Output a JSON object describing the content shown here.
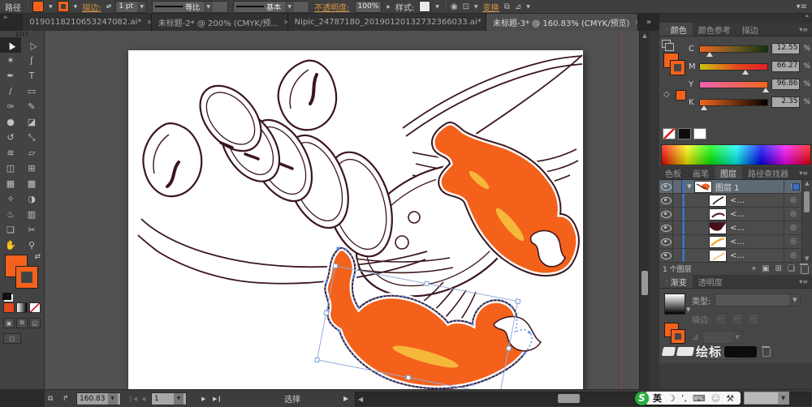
{
  "control_bar": {
    "context_label": "路径",
    "stroke_link": "描边:",
    "stroke_weight": "1 pt",
    "profile_label": "等比",
    "brush_label": "基本",
    "opacity_link": "不透明度:",
    "opacity_value": "100%",
    "style_label": "样式:",
    "transform_link": "变换"
  },
  "tab_bar": {
    "tabs": [
      {
        "label": "0190118210653247082.ai*",
        "close": "×"
      },
      {
        "label": "未标题-2* @ 200% (CMYK/预...",
        "close": "×"
      },
      {
        "label": "Nipic_24787180_20190120132732366033.ai*",
        "close": "×"
      },
      {
        "label": "未标题-3* @ 160.83% (CMYK/预览)",
        "close": "×"
      }
    ],
    "overflow": "»"
  },
  "toolbar": {
    "tools": [
      {
        "name": "selection",
        "glyph": "▲"
      },
      {
        "name": "direct-selection",
        "glyph": "△"
      },
      {
        "name": "magic-wand",
        "glyph": "✶"
      },
      {
        "name": "lasso",
        "glyph": "ʃ"
      },
      {
        "name": "pen",
        "glyph": "✒"
      },
      {
        "name": "type",
        "glyph": "T"
      },
      {
        "name": "line-segment",
        "glyph": "∕"
      },
      {
        "name": "rectangle",
        "glyph": "▭"
      },
      {
        "name": "paintbrush",
        "glyph": "✑"
      },
      {
        "name": "pencil",
        "glyph": "✎"
      },
      {
        "name": "blob-brush",
        "glyph": "●"
      },
      {
        "name": "eraser",
        "glyph": "◪"
      },
      {
        "name": "rotate",
        "glyph": "↺"
      },
      {
        "name": "scale",
        "glyph": "⤡"
      },
      {
        "name": "width",
        "glyph": "≋"
      },
      {
        "name": "free-transform",
        "glyph": "▱"
      },
      {
        "name": "shape-builder",
        "glyph": "◫"
      },
      {
        "name": "perspective-grid",
        "glyph": "⊞"
      },
      {
        "name": "mesh",
        "glyph": "▦"
      },
      {
        "name": "gradient",
        "glyph": "▩"
      },
      {
        "name": "eyedropper",
        "glyph": "✧"
      },
      {
        "name": "blend",
        "glyph": "◑"
      },
      {
        "name": "symbol-sprayer",
        "glyph": "♨"
      },
      {
        "name": "column-graph",
        "glyph": "▥"
      },
      {
        "name": "artboard",
        "glyph": "❏"
      },
      {
        "name": "slice",
        "glyph": "✂"
      },
      {
        "name": "hand",
        "glyph": "✋"
      },
      {
        "name": "zoom",
        "glyph": "⚲"
      }
    ]
  },
  "color_panel": {
    "tabs": [
      "颜色",
      "颜色参考",
      "描边"
    ],
    "channels": [
      {
        "label": "C",
        "value": "12.55"
      },
      {
        "label": "M",
        "value": "66.27"
      },
      {
        "label": "Y",
        "value": "96.86"
      },
      {
        "label": "K",
        "value": "2.35"
      }
    ],
    "unit": "%"
  },
  "middle_panel": {
    "tabs": [
      "色板",
      "画笔",
      "图层",
      "路径查找器"
    ]
  },
  "layers_panel": {
    "layer_name": "图层 1",
    "sublayer_label": "<...",
    "footer": "1 个图层"
  },
  "gradient_panel": {
    "tabs": [
      "渐变",
      "透明度"
    ],
    "type_label": "类型:",
    "stroke_label": "描边:"
  },
  "watermark": {
    "text": "绘标"
  },
  "status_bar": {
    "zoom": "160.83",
    "artboard": "1",
    "mode": "选择"
  },
  "ime": {
    "logo": "S",
    "lang": "英"
  },
  "icons": {
    "dropdown": "▼",
    "popup": "▶",
    "menu": "▾≡",
    "collapse": "❝",
    "cycle": "◦",
    "scroll_up": "▲",
    "scroll_down": "▼",
    "arrow_left": "◀",
    "arrow_right": "▶",
    "nav_first": "❙◀",
    "nav_prev": "◀",
    "nav_next": "▶",
    "nav_last": "▶❙",
    "target": "◎",
    "disclosure": "▼",
    "swap": "⇄",
    "share": "↱",
    "frames": "⧉",
    "recolor": "◉",
    "align_box": "⊡",
    "isolate": "⊿",
    "stroke_corner": "⌐",
    "locate": "⌖",
    "clip_mask": "▣",
    "new_sublayer": "⊞",
    "new_layer": "❏",
    "screen_mode": "▢",
    "moon": "☽",
    "punct": "’,",
    "keyboard": "⌨",
    "person": "☺",
    "wrench": "⚒",
    "stepper": "▲▼",
    "angle": "⊿"
  },
  "colors": {
    "accent_orange": "#F4611B",
    "highlight_yellow": "#F6B83A",
    "outline_maroon": "#3B161E",
    "selection_blue": "#5B8DF0"
  }
}
